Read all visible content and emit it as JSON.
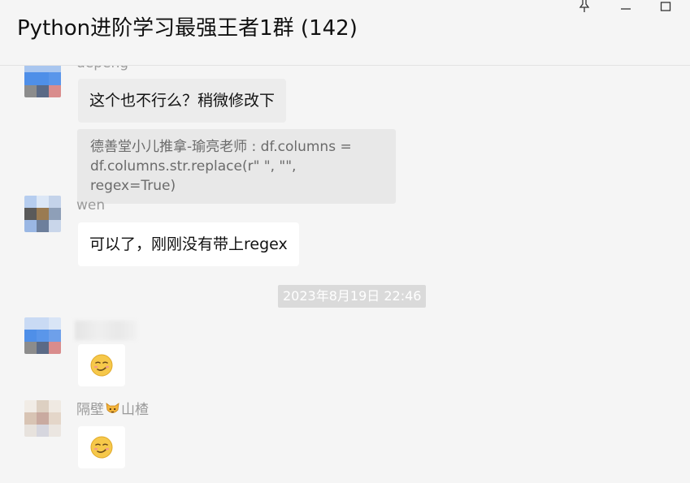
{
  "window": {
    "title": "Python进阶学习最强王者1群 (142)",
    "controls": {
      "pin_icon": "pin-icon",
      "minimize_icon": "minimize-icon",
      "maximize_icon": "maximize-icon"
    }
  },
  "messages": [
    {
      "sender": "depeng",
      "text": "这个也不行么？稍微修改下",
      "quote": "德善堂小儿推拿-瑜亮老师 : df.columns = df.columns.str.replace(r\" \", \"\", regex=True)"
    },
    {
      "sender": "wen",
      "text": "可以了，刚刚没有带上regex"
    },
    {
      "timestamp": "2023年8月19日 22:46"
    },
    {
      "sender": "",
      "emoji": "smirk-emoji-icon"
    },
    {
      "sender_prefix": "隔壁",
      "sender_emoji": "cat-face-icon",
      "sender_suffix": "山楂",
      "emoji": "smirk-emoji-icon"
    }
  ],
  "colors": {
    "background": "#f5f5f5",
    "bubble": "#ffffff",
    "quote_bg": "#e8e8e8",
    "timestamp_bg": "#dadada",
    "sender_text": "#9a9a9a"
  }
}
